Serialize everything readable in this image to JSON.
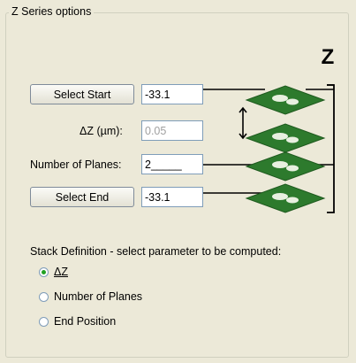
{
  "group": {
    "title": "Z Series options"
  },
  "z_axis_label": "Z",
  "buttons": {
    "select_start": "Select Start",
    "select_end": "Select End"
  },
  "fields": {
    "start_value": "-33.1",
    "delta_z_label": "ΔZ (µm):",
    "delta_z_value": "0.05",
    "num_planes_label": "Number of Planes:",
    "num_planes_value": "2_____",
    "end_value": "-33.1"
  },
  "stack_definition": {
    "heading": "Stack Definition - select parameter to be computed:",
    "options": [
      {
        "label": "ΔZ",
        "selected": true
      },
      {
        "label": "Number of Planes",
        "selected": false
      },
      {
        "label": "End Position",
        "selected": false
      }
    ]
  },
  "colors": {
    "plane": "#2d7a2d",
    "plane_dark": "#1f5a1f",
    "cell": "#e8f0e0"
  }
}
